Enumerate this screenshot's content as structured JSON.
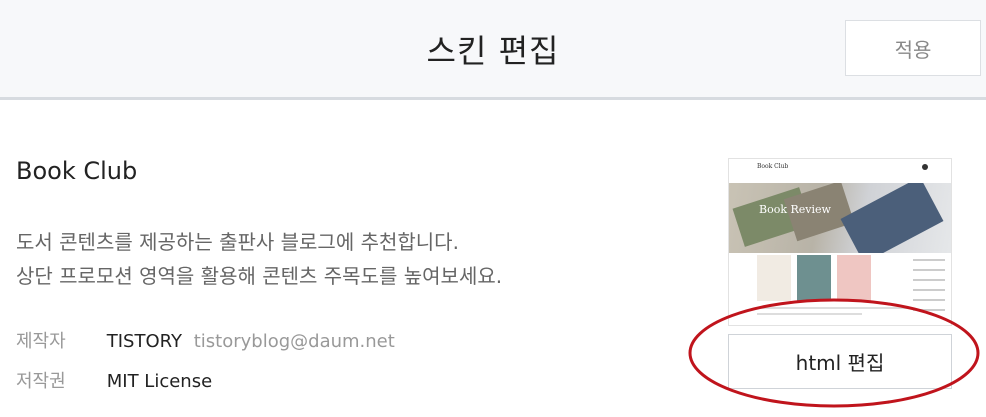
{
  "header": {
    "title": "스킨 편집",
    "apply_label": "적용"
  },
  "skin": {
    "name": "Book Club",
    "description_line1": "도서 콘텐츠를 제공하는 출판사 블로그에 추천합니다.",
    "description_line2": "상단 프로모션 영역을 활용해 콘텐츠 주목도를 높여보세요.",
    "maker_label": "제작자",
    "maker_name": "TISTORY",
    "maker_email": "tistoryblog@daum.net",
    "license_label": "저작권",
    "license_value": "MIT License"
  },
  "preview": {
    "site_title": "Book Club",
    "banner_text": "Book Review"
  },
  "actions": {
    "html_edit_label": "html 편집"
  },
  "colors": {
    "annotation": "#c0141c",
    "header_bg": "#f7f8fa"
  }
}
